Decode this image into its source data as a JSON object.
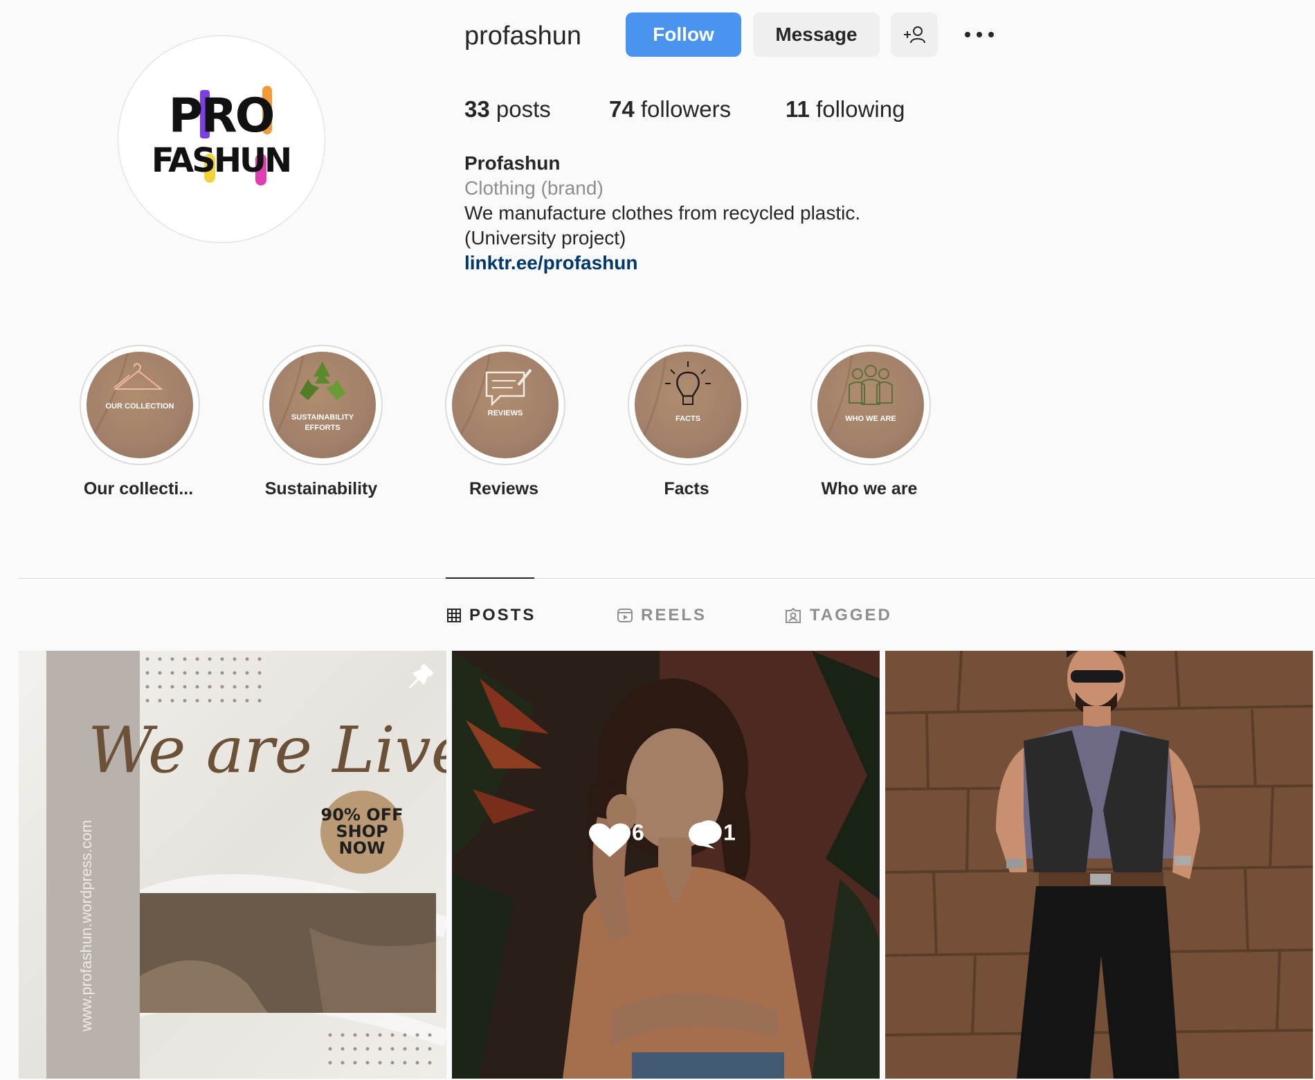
{
  "profile": {
    "username": "profashun",
    "display_name": "Profashun",
    "category": "Clothing (brand)",
    "bio_line_1": "We manufacture clothes from recycled plastic.",
    "bio_line_2": "(University project)",
    "link": "linktr.ee/profashun",
    "logo_text_line_1": "PRO",
    "logo_text_line_2": "FASHUN"
  },
  "actions": {
    "follow_label": "Follow",
    "message_label": "Message",
    "add_user_icon": "add-user-icon",
    "more_icon": "more-options-icon"
  },
  "stats": {
    "posts_count": "33",
    "posts_label": "posts",
    "followers_count": "74",
    "followers_label": "followers",
    "following_count": "11",
    "following_label": "following"
  },
  "highlights": [
    {
      "label": "Our collecti...",
      "cover_text": "OUR COLLECTION",
      "icon": "hanger-icon"
    },
    {
      "label": "Sustainability",
      "cover_text_1": "SUSTAINABILITY",
      "cover_text_2": "EFFORTS",
      "icon": "recycle-icon"
    },
    {
      "label": "Reviews",
      "cover_text": "REVIEWS",
      "icon": "speech-bubble-icon"
    },
    {
      "label": "Facts",
      "cover_text": "FACTS",
      "icon": "lightbulb-icon"
    },
    {
      "label": "Who we are",
      "cover_text": "WHO WE ARE",
      "icon": "people-icon"
    }
  ],
  "tabs": [
    {
      "label": "POSTS",
      "icon": "grid-icon",
      "active": true
    },
    {
      "label": "REELS",
      "icon": "reels-icon",
      "active": false
    },
    {
      "label": "TAGGED",
      "icon": "tagged-icon",
      "active": false
    }
  ],
  "posts": [
    {
      "type": "graphic",
      "headline": "We are Live!",
      "badge_line_1": "90% OFF",
      "badge_line_2": "SHOP",
      "badge_line_3": "NOW",
      "side_text": "www.profashun.wordpress.com",
      "pinned_icon": "pin-icon"
    },
    {
      "type": "photo",
      "likes": "6",
      "comments": "1",
      "like_icon": "heart-icon",
      "comment_icon": "comment-icon"
    },
    {
      "type": "photo"
    }
  ],
  "colors": {
    "follow_button": "#4a94ef",
    "link": "#00376b",
    "highlight_cover": "#a2806a",
    "muted_text": "#8e8e8e"
  }
}
